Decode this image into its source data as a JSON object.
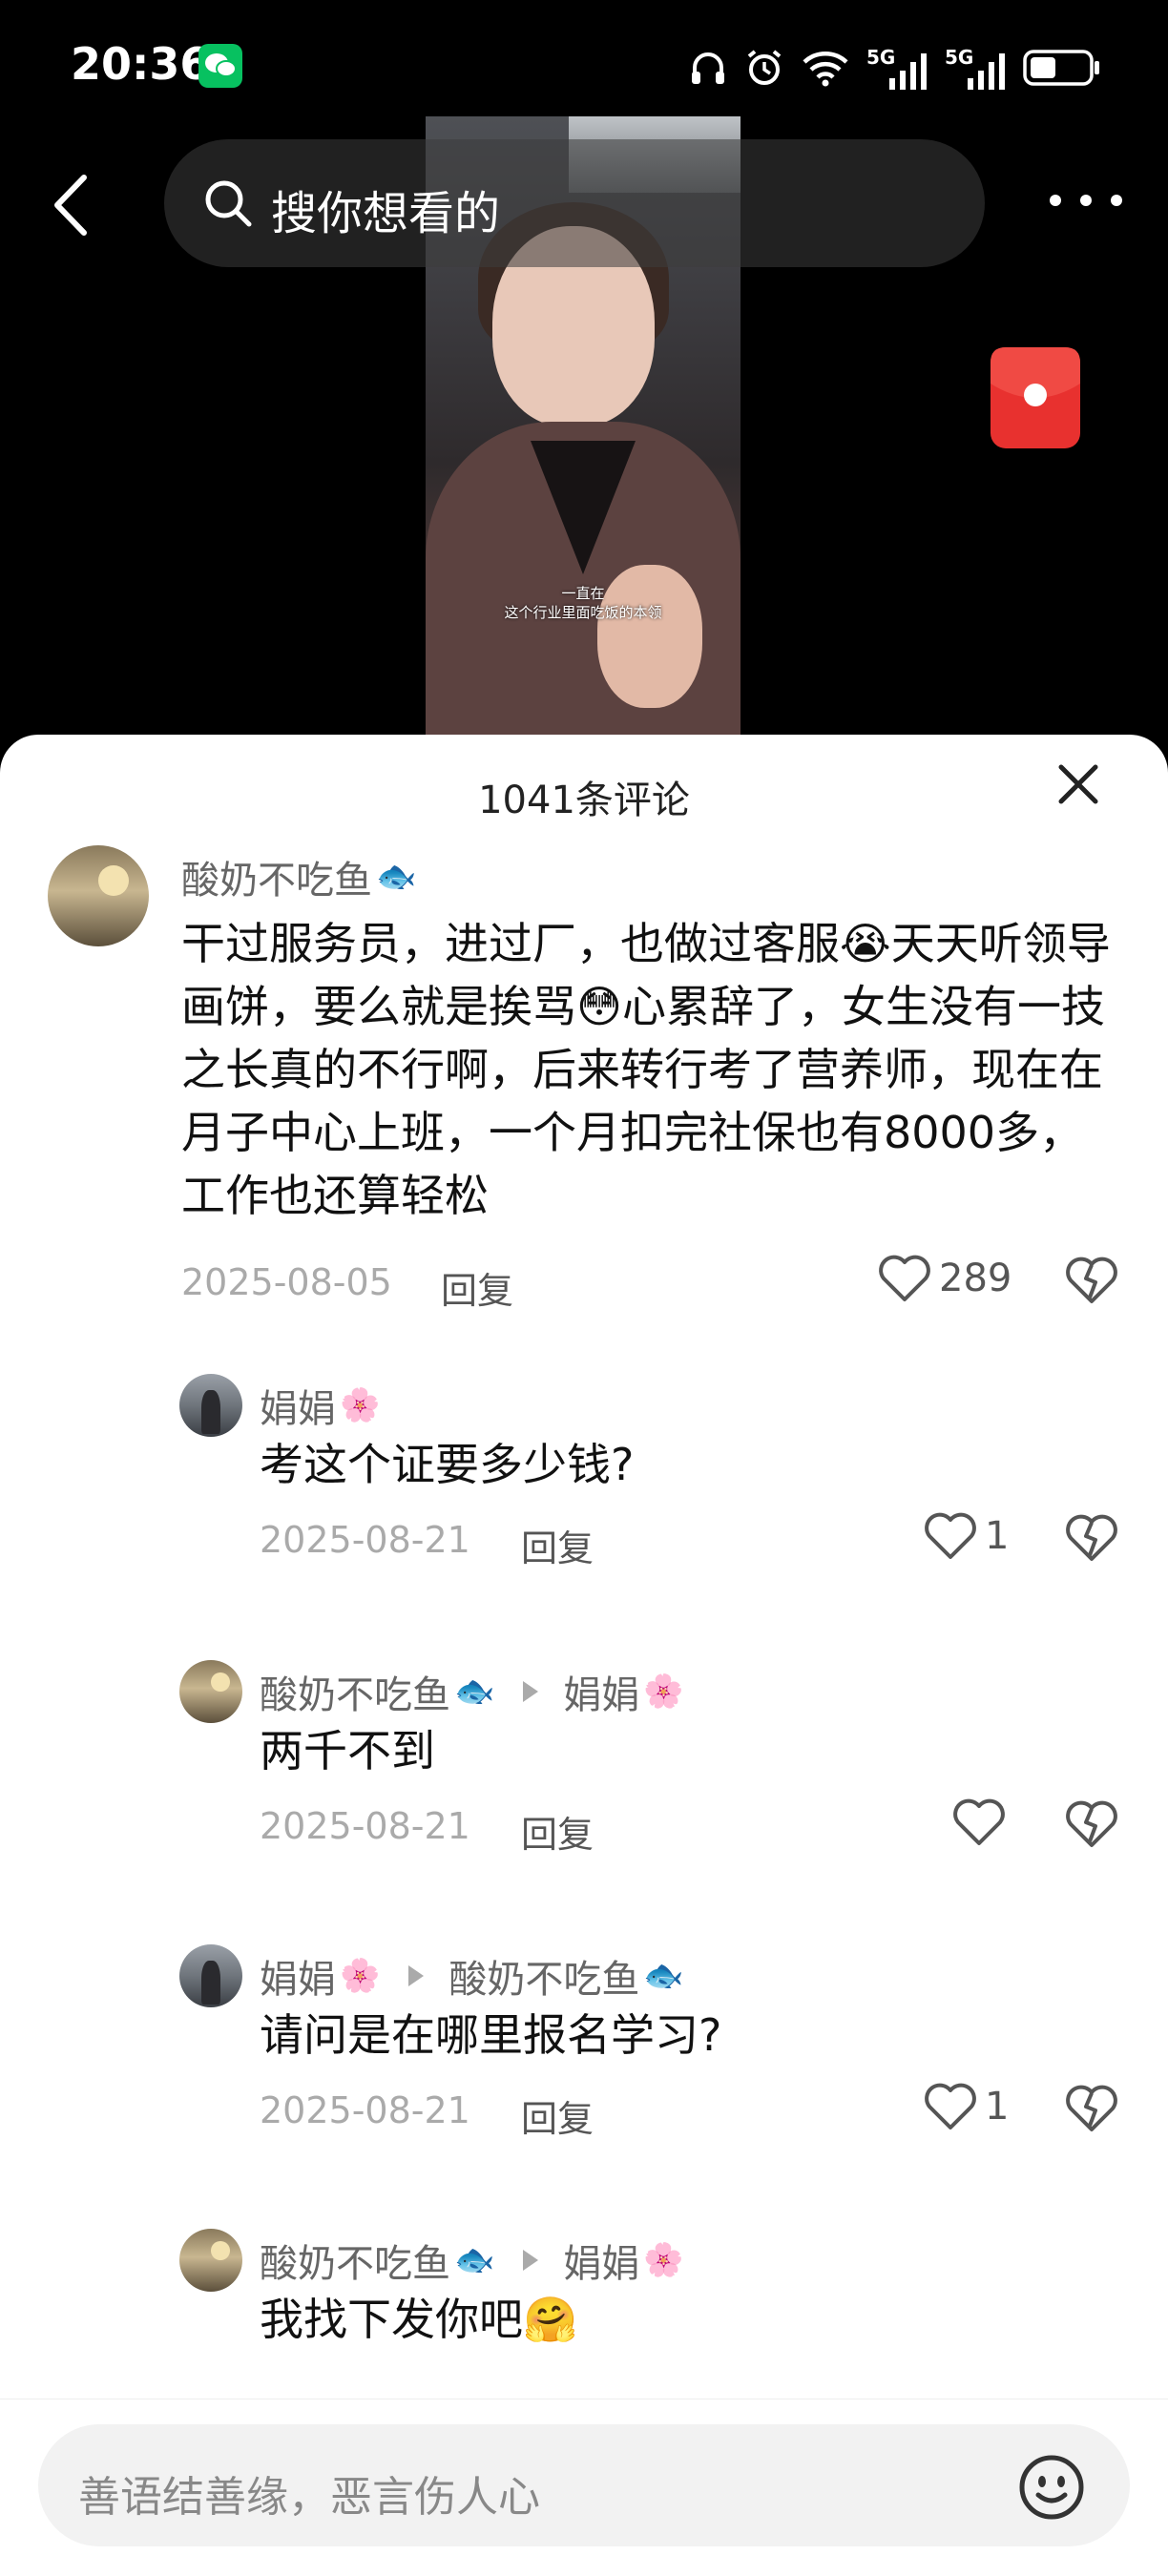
{
  "status": {
    "time": "20:36",
    "network1": "5G",
    "network2": "5G"
  },
  "video": {
    "caption_line1": "一直在",
    "caption_line2": "这个行业里面吃饭的本领"
  },
  "search": {
    "placeholder": "搜你想看的"
  },
  "comments_header": {
    "title": "1041条评论"
  },
  "comments": [
    {
      "user": "酸奶不吃鱼",
      "user_emoji": "🐟",
      "text": "干过服务员，进过厂，也做过客服😭天天听领导画饼，要么就是挨骂😳心累辞了，女生没有一技之长真的不行啊，后来转行考了营养师，现在在月子中心上班，一个月扣完社保也有8000多，工作也还算轻松",
      "date": "2025-08-05",
      "reply_label": "回复",
      "likes": "289"
    }
  ],
  "replies": [
    {
      "user": "娟娟",
      "user_emoji": "🌸",
      "reply_to": "",
      "reply_to_emoji": "",
      "text": "考这个证要多少钱?",
      "date": "2025-08-21",
      "reply_label": "回复",
      "likes": "1"
    },
    {
      "user": "酸奶不吃鱼",
      "user_emoji": "🐟",
      "reply_to": "娟娟",
      "reply_to_emoji": "🌸",
      "text": "两千不到",
      "date": "2025-08-21",
      "reply_label": "回复",
      "likes": ""
    },
    {
      "user": "娟娟",
      "user_emoji": "🌸",
      "reply_to": "酸奶不吃鱼",
      "reply_to_emoji": "🐟",
      "text": "请问是在哪里报名学习?",
      "date": "2025-08-21",
      "reply_label": "回复",
      "likes": "1"
    },
    {
      "user": "酸奶不吃鱼",
      "user_emoji": "🐟",
      "reply_to": "娟娟",
      "reply_to_emoji": "🌸",
      "text": "我找下发你吧🤗",
      "date": "",
      "reply_label": "",
      "likes": ""
    }
  ],
  "input": {
    "placeholder": "善语结善缘，恶言伤人心"
  },
  "icons": [
    "back-icon",
    "search-icon",
    "more-icon",
    "red-packet-icon",
    "close-icon",
    "heart-icon",
    "broken-heart-icon",
    "emoji-icon"
  ]
}
